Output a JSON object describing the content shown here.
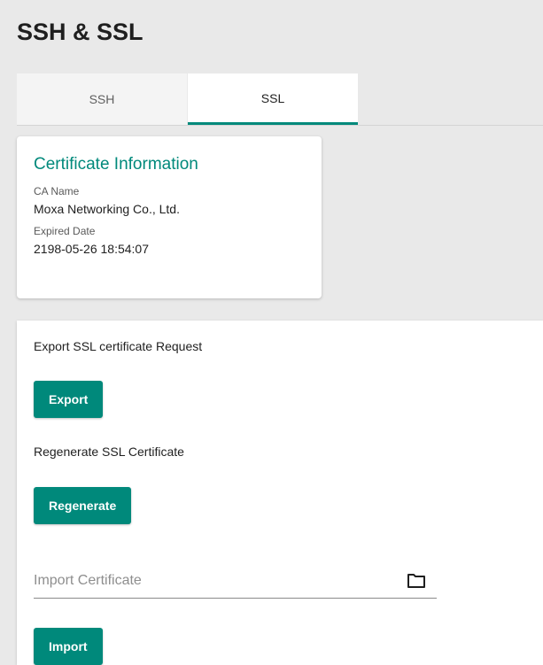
{
  "page": {
    "title": "SSH & SSL"
  },
  "tabs": [
    {
      "label": "SSH",
      "active": false
    },
    {
      "label": "SSL",
      "active": true
    }
  ],
  "certificate": {
    "title": "Certificate Information",
    "ca_name_label": "CA Name",
    "ca_name": "Moxa Networking Co., Ltd.",
    "expired_label": "Expired Date",
    "expired": "2198-05-26 18:54:07"
  },
  "export": {
    "label": "Export SSL certificate Request",
    "button": "Export"
  },
  "regenerate": {
    "label": "Regenerate SSL Certificate",
    "button": "Regenerate"
  },
  "import": {
    "placeholder": "Import Certificate",
    "icon": "folder-icon",
    "button": "Import"
  },
  "colors": {
    "accent": "#00897b",
    "background": "#e9e9e9"
  }
}
